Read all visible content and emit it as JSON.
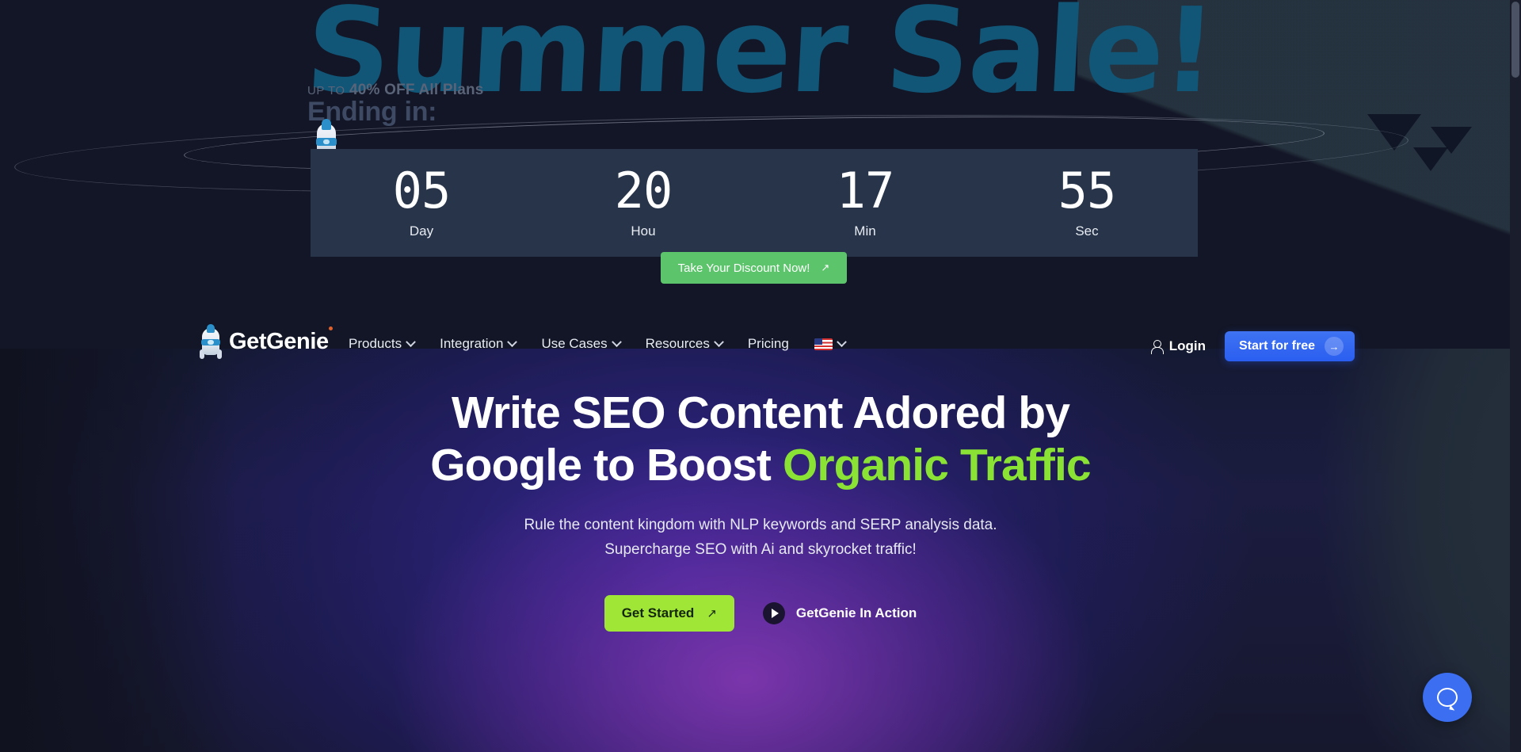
{
  "promo": {
    "headline": "Summer Sale!",
    "upto_small": "UP TO",
    "upto_main": "40% OFF All Plans",
    "ending_label": "Ending in:",
    "countdown": [
      {
        "value": "05",
        "label": "Day"
      },
      {
        "value": "20",
        "label": "Hou"
      },
      {
        "value": "17",
        "label": "Min"
      },
      {
        "value": "55",
        "label": "Sec"
      }
    ],
    "cta_label": "Take Your Discount Now!",
    "cta_arrow": "↗",
    "cta_color": "#5cc46a",
    "headline_color": "#115577"
  },
  "nav": {
    "brand": "GetGenie",
    "links": [
      {
        "label": "Products",
        "has_dropdown": true
      },
      {
        "label": "Integration",
        "has_dropdown": true
      },
      {
        "label": "Use Cases",
        "has_dropdown": true
      },
      {
        "label": "Resources",
        "has_dropdown": true
      },
      {
        "label": "Pricing",
        "has_dropdown": false
      }
    ],
    "locale_flag": "us-flag",
    "login_label": "Login",
    "start_label": "Start for free",
    "start_arrow": "→",
    "start_color": "#2a5ef0"
  },
  "hero": {
    "heading_line1": "Write SEO Content Adored by",
    "heading_line2_plain": "Google to Boost ",
    "heading_line2_accent": "Organic Traffic",
    "accent_color": "#8ae234",
    "sub_line1": "Rule the content kingdom with NLP keywords and SERP analysis data.",
    "sub_line2": "Supercharge SEO with Ai and skyrocket traffic!",
    "primary_cta": "Get Started",
    "primary_cta_arrow": "↗",
    "primary_cta_color": "#a0e636",
    "video_cta": "GetGenie In Action"
  },
  "widgets": {
    "chat_color": "#3b6ef0"
  }
}
